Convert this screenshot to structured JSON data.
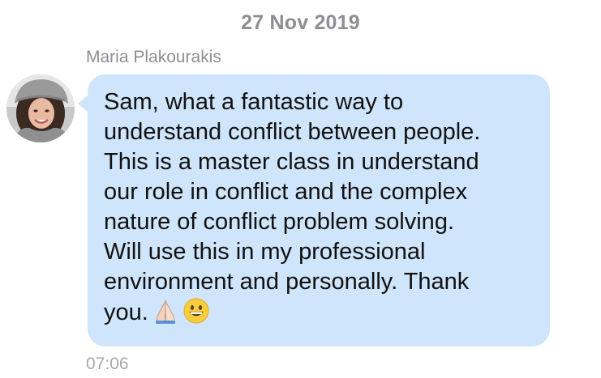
{
  "chat": {
    "date_header": "27 Nov 2019",
    "message": {
      "sender_name": "Maria Plakourakis",
      "avatar_icon": "user-photo-avatar",
      "text": "Sam, what a fantastic way to\nunderstand conflict between people.\nThis is a master class in understand\nour role in conflict and the complex\nnature of conflict problem solving.\nWill use this in my professional\nenvironment and personally. Thank\nyou.",
      "emojis": [
        "folded-hands-icon",
        "grinning-face-icon"
      ],
      "time": "07:06",
      "bubble_color": "#cfe5fb"
    }
  },
  "colors": {
    "meta_text": "#8e8e93",
    "message_text": "#111111",
    "background": "#ffffff"
  }
}
